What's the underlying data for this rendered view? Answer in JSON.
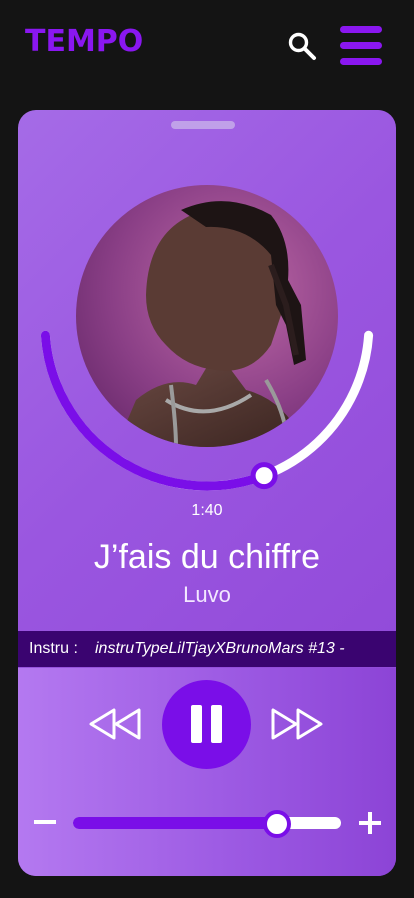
{
  "app": {
    "logo": "TEMPO"
  },
  "header": {
    "search_icon": "search-icon",
    "menu_icon": "hamburger-menu-icon"
  },
  "player": {
    "elapsed": "1:40",
    "progress_fraction": 0.62,
    "track_title": "J’fais du chiffre",
    "artist": "Luvo",
    "ticker_label": "Instru :",
    "ticker_value": "instruTypeLilTjayXBrunoMars #13 -",
    "controls": {
      "rewind_icon": "rewind-icon",
      "pause_icon": "pause-icon",
      "forward_icon": "fast-forward-icon"
    },
    "volume_fraction": 0.76,
    "volume_down_icon": "minus-icon",
    "volume_up_icon": "plus-icon"
  },
  "colors": {
    "accent": "#7a0ee8",
    "logo": "#8a17f0",
    "background": "#141414",
    "ticker_bg": "#3a0470",
    "card": "#9a56e0"
  }
}
